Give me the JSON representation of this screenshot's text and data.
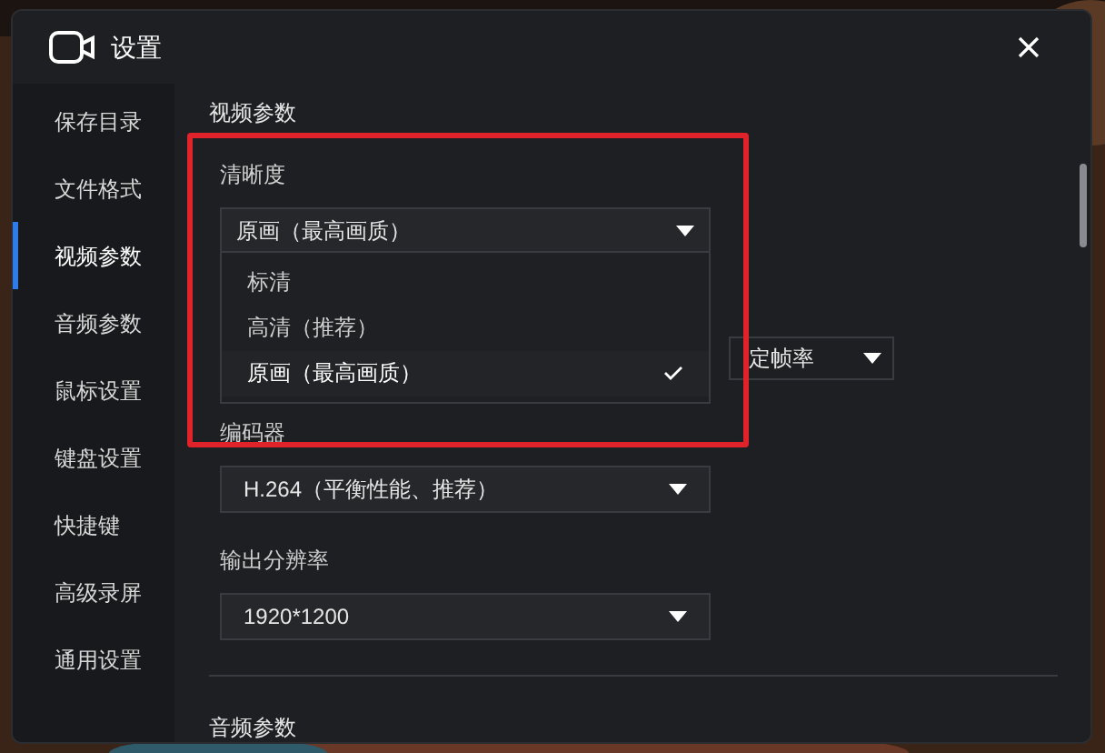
{
  "window": {
    "title": "设置"
  },
  "sidebar": {
    "items": [
      {
        "label": "保存目录",
        "selected": false
      },
      {
        "label": "文件格式",
        "selected": false
      },
      {
        "label": "视频参数",
        "selected": true
      },
      {
        "label": "音频参数",
        "selected": false
      },
      {
        "label": "鼠标设置",
        "selected": false
      },
      {
        "label": "键盘设置",
        "selected": false
      },
      {
        "label": "快捷键",
        "selected": false
      },
      {
        "label": "高级录屏",
        "selected": false
      },
      {
        "label": "通用设置",
        "selected": false
      }
    ]
  },
  "section_title": "视频参数",
  "clarity": {
    "label": "清晰度",
    "value": "原画（最高画质）",
    "expanded": true,
    "options": [
      {
        "label": "标清",
        "selected": false
      },
      {
        "label": "高清（推荐）",
        "selected": false
      },
      {
        "label": "原画（最高画质）",
        "selected": true
      }
    ]
  },
  "frame_rate_mode": {
    "value": "定帧率"
  },
  "encoder": {
    "label": "编码器",
    "value": "H.264（平衡性能、推荐）"
  },
  "resolution": {
    "label": "输出分辨率",
    "value": "1920*1200"
  },
  "next_section_title": "音频参数"
}
